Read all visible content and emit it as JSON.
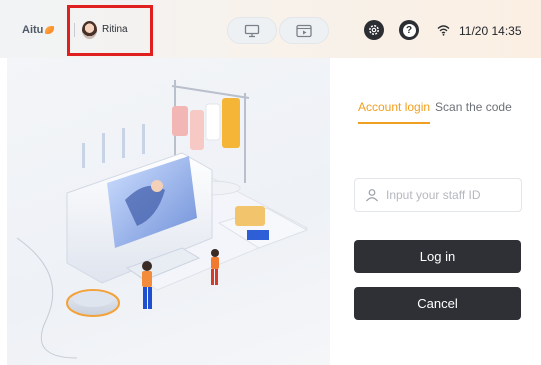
{
  "header": {
    "logo_text": "Aitu",
    "user_name": "Ritina",
    "mode_buttons": [
      {
        "icon": "desk-monitor-icon"
      },
      {
        "icon": "video-screen-icon"
      }
    ],
    "settings_icon": "gear-icon",
    "help_icon": "question-icon",
    "help_glyph": "?",
    "wifi_icon": "wifi-icon",
    "datetime": "11/20 14:35"
  },
  "login": {
    "tabs": [
      {
        "label": "Account login",
        "active": true
      },
      {
        "label": "Scan the code",
        "active": false
      }
    ],
    "staff_id": {
      "placeholder": "Input your staff ID",
      "value": ""
    },
    "login_button": "Log in",
    "cancel_button": "Cancel"
  },
  "colors": {
    "accent": "#f0a020",
    "button_dark": "#2e3035",
    "highlight_box": "#e0201e"
  }
}
